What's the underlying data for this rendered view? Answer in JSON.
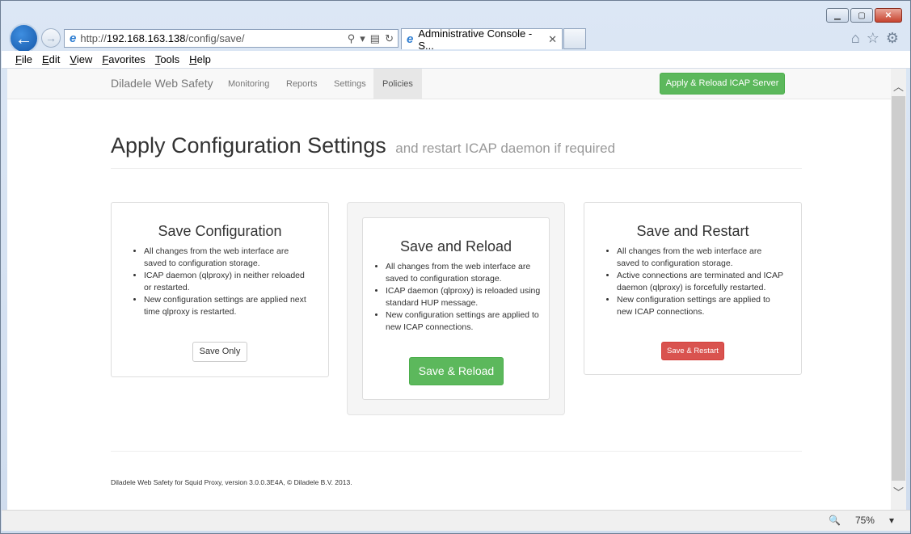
{
  "browser": {
    "url_prefix": "http://",
    "url_host": "192.168.163.138",
    "url_path": "/config/save/",
    "tab_title": "Administrative Console - S...",
    "menu": [
      "File",
      "Edit",
      "View",
      "Favorites",
      "Tools",
      "Help"
    ],
    "zoom_level": "75%"
  },
  "navbar": {
    "brand": "Diladele Web Safety",
    "items": [
      "Monitoring",
      "Reports",
      "Settings",
      "Policies"
    ],
    "active_item": "Policies",
    "apply_button": "Apply & Reload ICAP Server"
  },
  "header": {
    "title": "Apply Configuration Settings",
    "subtitle": "and restart ICAP daemon if required"
  },
  "panels": [
    {
      "title": "Save Configuration",
      "bullets": [
        "All changes from the web interface are saved to configuration storage.",
        "ICAP daemon (qlproxy) in neither reloaded or restarted.",
        "New configuration settings are applied next time qlproxy is restarted."
      ],
      "button": "Save Only"
    },
    {
      "title": "Save and Reload",
      "bullets": [
        "All changes from the web interface are saved to configuration storage.",
        "ICAP daemon (qlproxy) is reloaded using standard HUP message.",
        "New configuration settings are applied to new ICAP connections."
      ],
      "button": "Save & Reload"
    },
    {
      "title": "Save and Restart",
      "bullets": [
        "All changes from the web interface are saved to configuration storage.",
        "Active connections are terminated and ICAP daemon (qlproxy) is forcefully restarted.",
        "New configuration settings are applied to new ICAP connections."
      ],
      "button": "Save & Restart"
    }
  ],
  "footer": {
    "text": "Diladele Web Safety for Squid Proxy, version 3.0.0.3E4A, © Diladele B.V. 2013."
  },
  "colors": {
    "success": "#5cb85c",
    "danger": "#d9534f",
    "ie_blue": "#1557a8"
  }
}
